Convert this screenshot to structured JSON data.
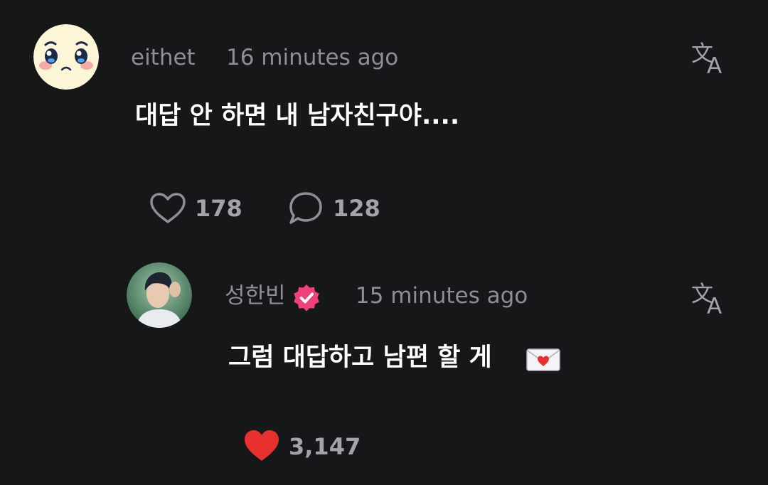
{
  "comments": [
    {
      "username": "eithet",
      "time": "16 minutes ago",
      "text": "대답 안 하면 내 남자친구야....",
      "likes": "178",
      "replies": "128",
      "liked": false
    },
    {
      "username": "성한빈",
      "verified": true,
      "time": "15 minutes ago",
      "text": "그럼 대답하고 남편 할 게",
      "text_emoji": "love-letter",
      "likes": "3,147",
      "liked": true
    }
  ],
  "colors": {
    "background": "#161719",
    "muted_text": "#8e8e96",
    "like_red": "#e8312f",
    "verified_pink": "#f0407a"
  },
  "icons": {
    "translate": "translate-icon",
    "heart_outline": "heart-outline-icon",
    "heart_filled": "heart-filled-icon",
    "comment": "comment-bubble-icon",
    "verified": "verified-badge-icon"
  }
}
